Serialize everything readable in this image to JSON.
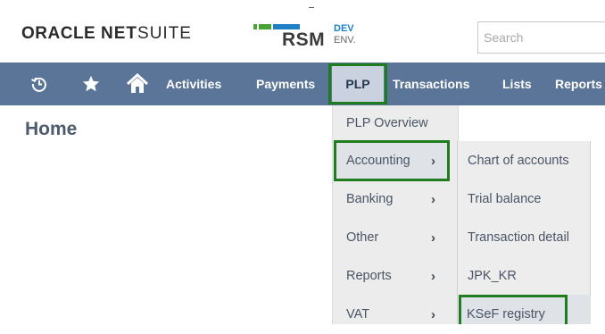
{
  "header": {
    "oracle_brand_oracle": "ORACLE",
    "oracle_brand_net": "NET",
    "oracle_brand_suite": "SUITE",
    "rsm_logo": "RSM",
    "env_label_dev": "DEV",
    "env_label_env": "ENV.",
    "search": {
      "placeholder": "Search",
      "value": ""
    },
    "colors": {
      "rsm_green": "#4aa232",
      "rsm_blue": "#1e7fc4"
    }
  },
  "nav": {
    "background": "#5a7598",
    "icons": [
      "recent-records-icon",
      "favorites-star-icon",
      "home-icon"
    ],
    "items": [
      {
        "label": "Activities"
      },
      {
        "label": "Payments"
      },
      {
        "label": "PLP",
        "active": true
      },
      {
        "label": "Transactions"
      },
      {
        "label": "Lists"
      },
      {
        "label": "Reports"
      }
    ]
  },
  "page": {
    "title": "Home"
  },
  "plp_menu": {
    "items": [
      {
        "label": "PLP Overview",
        "has_submenu": false
      },
      {
        "label": "Accounting",
        "has_submenu": true,
        "active": true
      },
      {
        "label": "Banking",
        "has_submenu": true
      },
      {
        "label": "Other",
        "has_submenu": true
      },
      {
        "label": "Reports",
        "has_submenu": true
      },
      {
        "label": "VAT",
        "has_submenu": true
      }
    ]
  },
  "accounting_submenu": {
    "items": [
      {
        "label": "Chart of accounts"
      },
      {
        "label": "Trial balance"
      },
      {
        "label": "Transaction detail"
      },
      {
        "label": "JPK_KR"
      },
      {
        "label": "KSeF registry",
        "highlighted": true
      }
    ]
  },
  "highlight_color": "#1f7d1f"
}
